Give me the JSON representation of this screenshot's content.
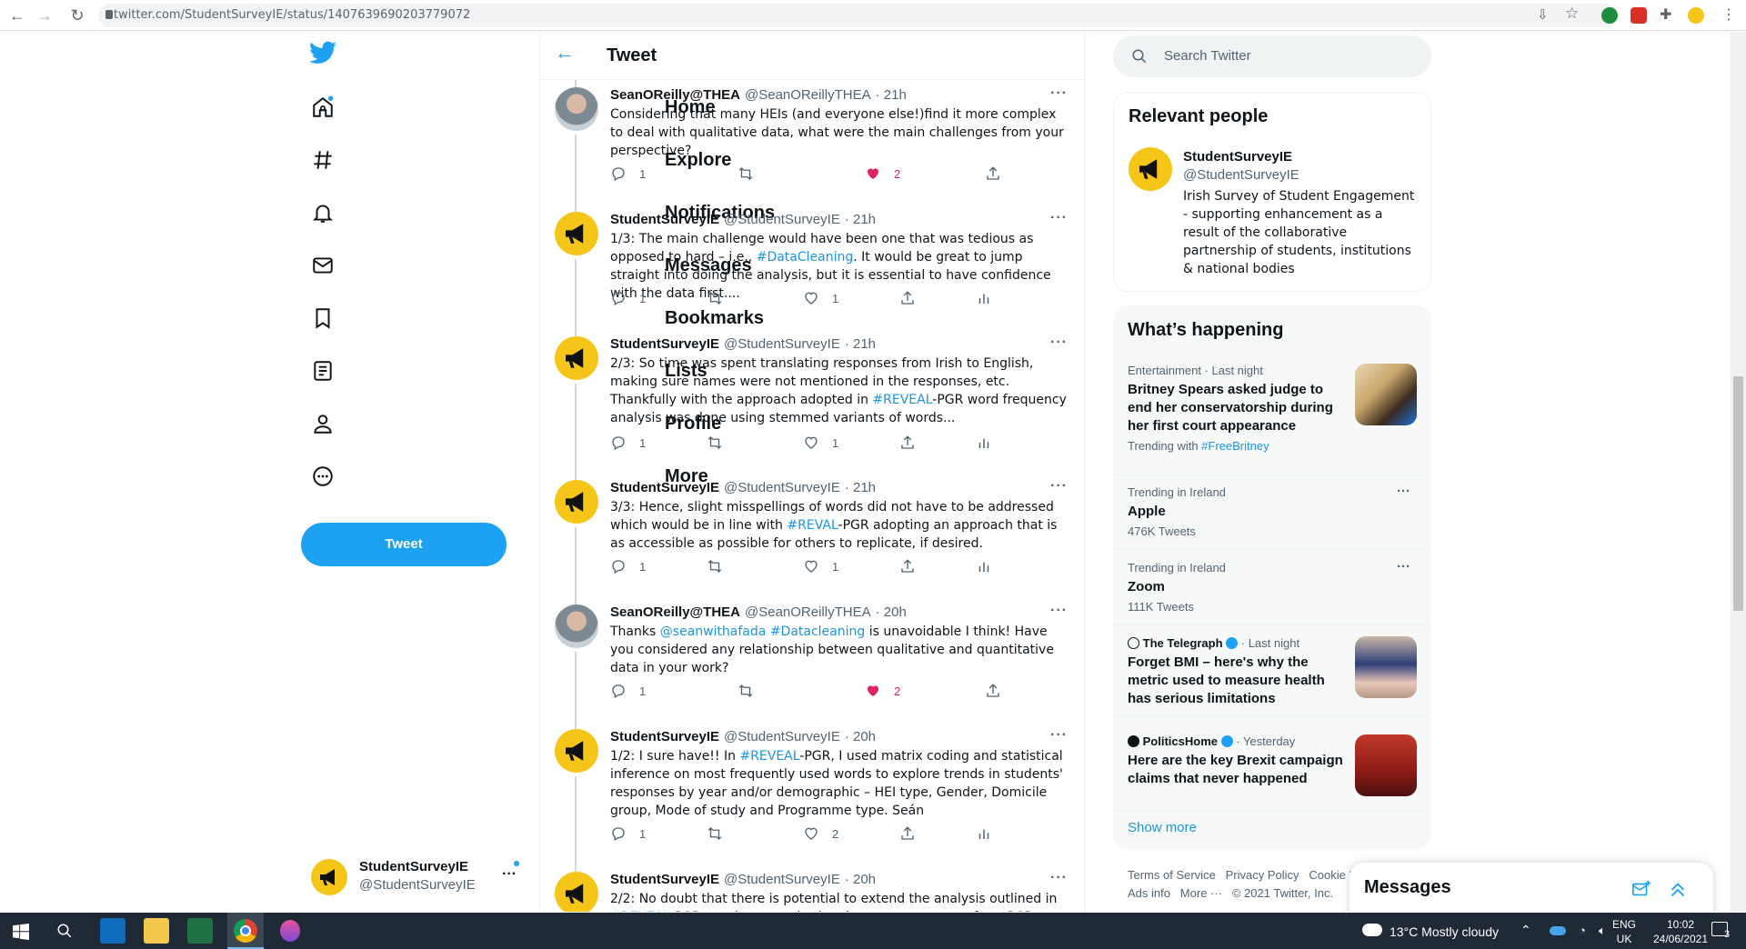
{
  "browser": {
    "url": "twitter.com/StudentSurveyIE/status/1407639690203779072"
  },
  "nav": {
    "items": [
      {
        "label": "Home",
        "icon": "home-icon"
      },
      {
        "label": "Explore",
        "icon": "hashtag-icon"
      },
      {
        "label": "Notifications",
        "icon": "bell-icon"
      },
      {
        "label": "Messages",
        "icon": "envelope-icon"
      },
      {
        "label": "Bookmarks",
        "icon": "bookmark-icon"
      },
      {
        "label": "Lists",
        "icon": "list-icon"
      },
      {
        "label": "Profile",
        "icon": "person-icon"
      },
      {
        "label": "More",
        "icon": "more-circle-icon"
      }
    ],
    "tweet_button": "Tweet",
    "account_name": "StudentSurveyIE",
    "account_handle": "@StudentSurveyIE"
  },
  "header": {
    "title": "Tweet"
  },
  "tweets": [
    {
      "name": "SeanOReilly@THEA",
      "handle": "@SeanOReillyTHEA",
      "time": "· 21h",
      "text_parts": [
        {
          "t": "Considering that many HEIs (and everyone else!)find it more complex to deal with qualitative data, what were the main challenges from your perspective?",
          "link": false
        }
      ],
      "replies": "1",
      "retweets": "",
      "likes": "2",
      "liked": true,
      "analytics": false
    },
    {
      "name": "StudentSurveyIE",
      "handle": "@StudentSurveyIE",
      "time": "· 21h",
      "text_parts": [
        {
          "t": "1/3: The main challenge would have been one that was tedious as opposed to hard – i.e., ",
          "link": false
        },
        {
          "t": "#DataCleaning",
          "link": true
        },
        {
          "t": ". It would be great to jump straight into doing the analysis, but it is essential to have confidence with the data first....",
          "link": false
        }
      ],
      "replies": "1",
      "retweets": "",
      "likes": "1",
      "liked": false,
      "analytics": true
    },
    {
      "name": "StudentSurveyIE",
      "handle": "@StudentSurveyIE",
      "time": "· 21h",
      "text_parts": [
        {
          "t": "2/3: So time was spent translating responses from Irish to English, making sure names were not mentioned in the responses, etc. Thankfully with the approach adopted in ",
          "link": false
        },
        {
          "t": "#REVEAL",
          "link": true
        },
        {
          "t": "-PGR word frequency analysis was done using stemmed variants of words...",
          "link": false
        }
      ],
      "replies": "1",
      "retweets": "",
      "likes": "1",
      "liked": false,
      "analytics": true
    },
    {
      "name": "StudentSurveyIE",
      "handle": "@StudentSurveyIE",
      "time": "· 21h",
      "text_parts": [
        {
          "t": "3/3:  Hence, slight misspellings of words did not have to be addressed which would be in line with ",
          "link": false
        },
        {
          "t": "#REVAL",
          "link": true
        },
        {
          "t": "-PGR adopting an approach that is as accessible as possible for others to replicate, if desired.",
          "link": false
        }
      ],
      "replies": "1",
      "retweets": "",
      "likes": "1",
      "liked": false,
      "analytics": true
    },
    {
      "name": "SeanOReilly@THEA",
      "handle": "@SeanOReillyTHEA",
      "time": "· 20h",
      "text_parts": [
        {
          "t": "Thanks ",
          "link": false
        },
        {
          "t": "@seanwithafada",
          "link": true
        },
        {
          "t": " ",
          "link": false
        },
        {
          "t": "#Datacleaning",
          "link": true
        },
        {
          "t": " is unavoidable I think! Have you considered any relationship between qualitative and quantitative data in your work?",
          "link": false
        }
      ],
      "replies": "1",
      "retweets": "",
      "likes": "2",
      "liked": true,
      "analytics": false
    },
    {
      "name": "StudentSurveyIE",
      "handle": "@StudentSurveyIE",
      "time": "· 20h",
      "text_parts": [
        {
          "t": "1/2: I sure have!! In ",
          "link": false
        },
        {
          "t": "#REVEAL",
          "link": true
        },
        {
          "t": "-PGR, I used matrix coding and statistical inference on most frequently used words to explore trends in students' responses by year and/or demographic – HEI type, Gender, Domicile group, Mode of study and Programme type. Seán",
          "link": false
        }
      ],
      "replies": "1",
      "retweets": "",
      "likes": "2",
      "liked": false,
      "analytics": true
    },
    {
      "name": "StudentSurveyIE",
      "handle": "@StudentSurveyIE",
      "time": "· 20h",
      "text_parts": [
        {
          "t": "2/2: No doubt that there is potential to extend the analysis outlined in ",
          "link": false
        },
        {
          "t": "#REVEAL",
          "link": true
        },
        {
          "t": "-PGR to other quantitative data measurements from PGR...",
          "link": false
        }
      ],
      "replies": "",
      "retweets": "",
      "likes": "",
      "liked": false,
      "analytics": false
    }
  ],
  "search": {
    "placeholder": "Search Twitter"
  },
  "relevant": {
    "title": "Relevant people",
    "name": "StudentSurveyIE",
    "handle": "@StudentSurveyIE",
    "bio": "Irish Survey of Student Engagement - supporting enhancement as a result of the collaborative partnership of students, institutions & national bodies"
  },
  "happening": {
    "title": "What’s happening",
    "trends": [
      {
        "meta": "Entertainment · Last night",
        "title": "Britney Spears asked judge to end her conservatorship during her first court appearance",
        "sub_prefix": "Trending with ",
        "sub_link": "#FreeBritney"
      },
      {
        "meta": "Trending in Ireland",
        "title": "Apple",
        "count": "476K Tweets"
      },
      {
        "meta": "Trending in Ireland",
        "title": "Zoom",
        "count": "111K Tweets"
      },
      {
        "source": "The Telegraph",
        "meta": "· Last night",
        "title": "Forget BMI – here's why the metric used to measure health has serious limitations"
      },
      {
        "source": "PoliticsHome",
        "meta": "· Yesterday",
        "title": "Here are the key Brexit campaign claims that never happened"
      }
    ],
    "show_more": "Show more"
  },
  "footer": {
    "line1": "Terms of Service   Privacy Policy   Cookie P",
    "line2": "Ads info   More ···   © 2021 Twitter, Inc."
  },
  "messages_drawer": {
    "title": "Messages"
  },
  "taskbar": {
    "weather": "13°C  Mostly cloudy",
    "lang1": "ENG",
    "lang2": "UK",
    "time": "10:02",
    "date": "24/06/2021",
    "notifications": "3"
  },
  "colors": {
    "accent": "#1da1f2",
    "link": "#1b95e0",
    "like": "#e0245e",
    "muted": "#536471"
  }
}
